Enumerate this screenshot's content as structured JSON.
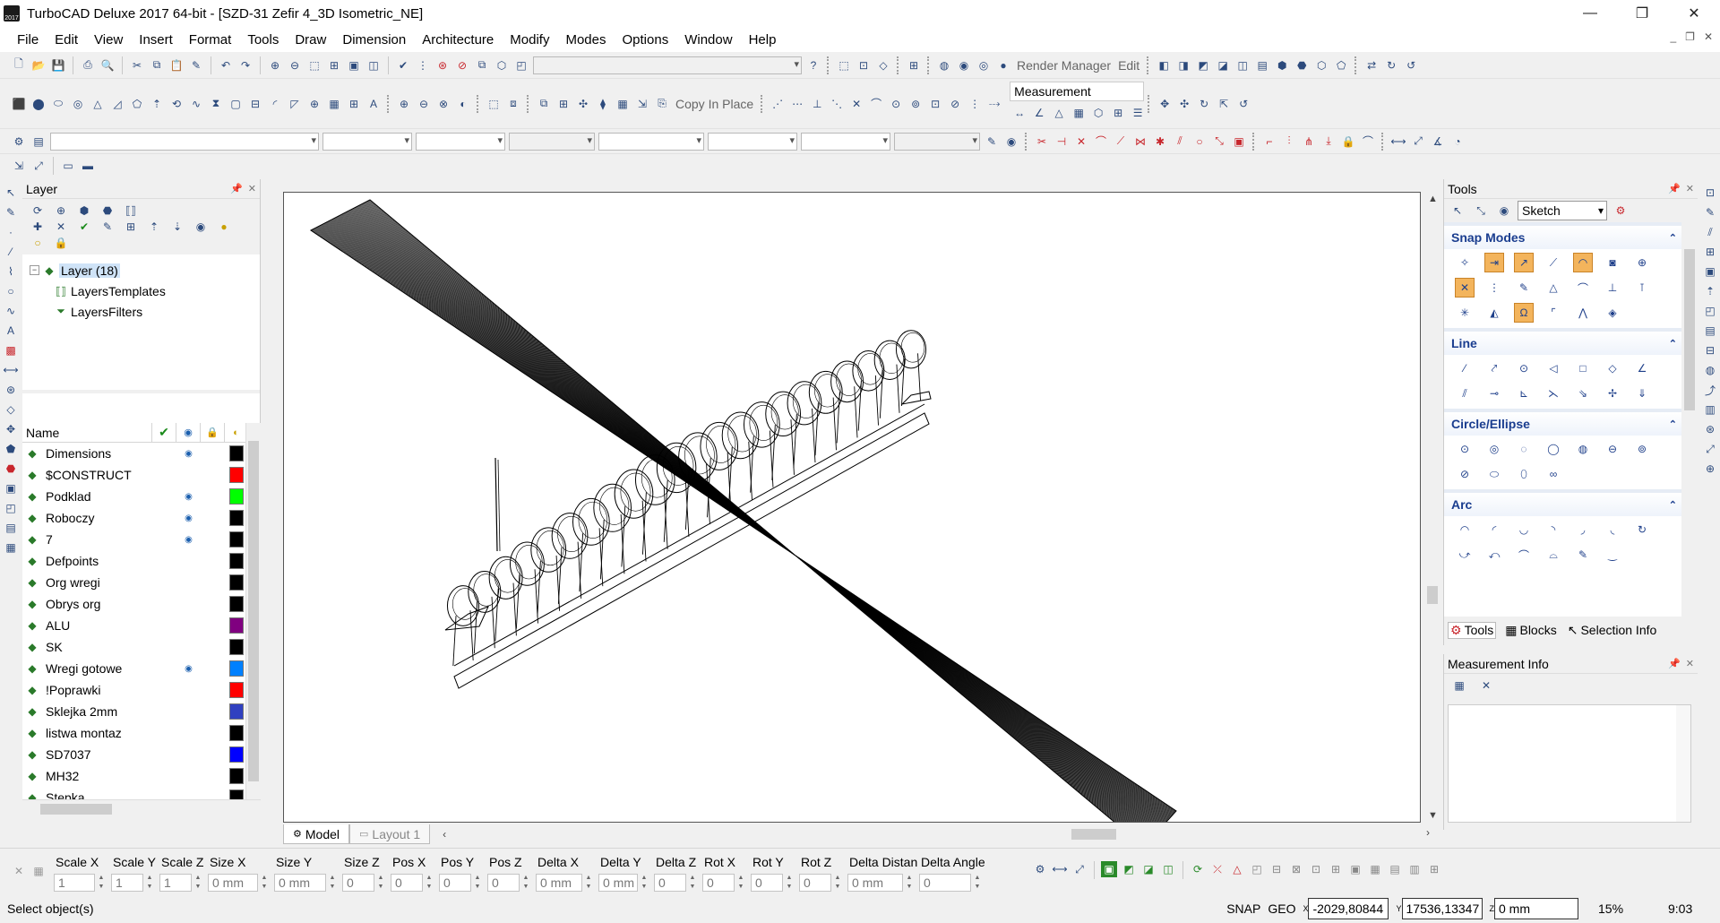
{
  "window": {
    "title": "TurboCAD Deluxe 2017 64-bit - [SZD-31 Zefir 4_3D Isometric_NE]",
    "app_icon_text": "2017",
    "minimize": "—",
    "restore": "❐",
    "close": "✕"
  },
  "menu": {
    "items": [
      {
        "label": "File"
      },
      {
        "label": "Edit"
      },
      {
        "label": "View"
      },
      {
        "label": "Insert"
      },
      {
        "label": "Format"
      },
      {
        "label": "Tools"
      },
      {
        "label": "Draw"
      },
      {
        "label": "Dimension"
      },
      {
        "label": "Architecture"
      },
      {
        "label": "Modify"
      },
      {
        "label": "Modes"
      },
      {
        "label": "Options"
      },
      {
        "label": "Window"
      },
      {
        "label": "Help"
      }
    ]
  },
  "toolbars": {
    "render_manager": "Render Manager",
    "edit": "Edit",
    "copy_in_place": "Copy In Place",
    "measurement": "Measurement"
  },
  "layer_panel": {
    "title": "Layer",
    "tree": {
      "root": "Layer (18)",
      "children": [
        "LayersTemplates",
        "LayersFilters"
      ]
    },
    "columns": {
      "name": "Name"
    },
    "layers": [
      {
        "name": "Dimensions",
        "visible": true,
        "color": "#000000"
      },
      {
        "name": "$CONSTRUCT",
        "visible": false,
        "color": "#ff0000"
      },
      {
        "name": "Podklad",
        "visible": true,
        "color": "#00ff00"
      },
      {
        "name": "Roboczy",
        "visible": true,
        "color": "#000000"
      },
      {
        "name": "7",
        "visible": true,
        "color": "#000000"
      },
      {
        "name": "Defpoints",
        "visible": false,
        "color": "#000000"
      },
      {
        "name": "Org wregi",
        "visible": false,
        "color": "#000000"
      },
      {
        "name": "Obrys org",
        "visible": false,
        "color": "#000000"
      },
      {
        "name": "ALU",
        "visible": false,
        "color": "#800080"
      },
      {
        "name": "SK",
        "visible": false,
        "color": "#000000"
      },
      {
        "name": "Wregi gotowe",
        "visible": true,
        "color": "#0080ff"
      },
      {
        "name": "!Poprawki",
        "visible": false,
        "color": "#ff0000"
      },
      {
        "name": "Sklejka 2mm",
        "visible": false,
        "color": "#3040c0"
      },
      {
        "name": "listwa montaz",
        "visible": false,
        "color": "#000000"
      },
      {
        "name": "SD7037",
        "visible": false,
        "color": "#0000ff"
      },
      {
        "name": "MH32",
        "visible": false,
        "color": "#000000"
      },
      {
        "name": "Stepka",
        "visible": false,
        "color": "#000000"
      }
    ]
  },
  "drawing": {
    "tabs": [
      {
        "label": "Model"
      },
      {
        "label": "Layout 1"
      }
    ]
  },
  "tools_panel": {
    "title": "Tools",
    "mode": "Sketch",
    "groups": [
      {
        "title": "Snap Modes"
      },
      {
        "title": "Line"
      },
      {
        "title": "Circle/Ellipse"
      },
      {
        "title": "Arc"
      }
    ],
    "tabs": [
      {
        "label": "Tools"
      },
      {
        "label": "Blocks"
      },
      {
        "label": "Selection Info"
      }
    ]
  },
  "measurement_info": {
    "title": "Measurement Info"
  },
  "coordinate_bar": {
    "fields": [
      {
        "label": "Scale X",
        "value": "1"
      },
      {
        "label": "Scale Y",
        "value": "1"
      },
      {
        "label": "Scale Z",
        "value": "1"
      },
      {
        "label": "Size X",
        "value": "0 mm"
      },
      {
        "label": "Size Y",
        "value": "0 mm"
      },
      {
        "label": "Size Z",
        "value": "0 mm"
      },
      {
        "label": "Pos X",
        "value": "0 mm"
      },
      {
        "label": "Pos Y",
        "value": "0 mm"
      },
      {
        "label": "Pos Z",
        "value": "0 mm"
      },
      {
        "label": "Delta X",
        "value": "0 mm"
      },
      {
        "label": "Delta Y",
        "value": "0 mm"
      },
      {
        "label": "Delta Z",
        "value": "0 mm"
      },
      {
        "label": "Rot X",
        "value": "0"
      },
      {
        "label": "Rot Y",
        "value": "0"
      },
      {
        "label": "Rot Z",
        "value": "0"
      },
      {
        "label": "Delta Distan",
        "value": "0 mm"
      },
      {
        "label": "Delta Angle",
        "value": "0"
      }
    ]
  },
  "status": {
    "message": "Select object(s)",
    "snap": "SNAP",
    "geo": "GEO",
    "x_label": "X",
    "x_value": "-2029,80844",
    "y_label": "Y",
    "y_value": "17536,13347",
    "z_label": "Z",
    "z_value": "0 mm",
    "zoom": "15%",
    "time": "9:03"
  }
}
